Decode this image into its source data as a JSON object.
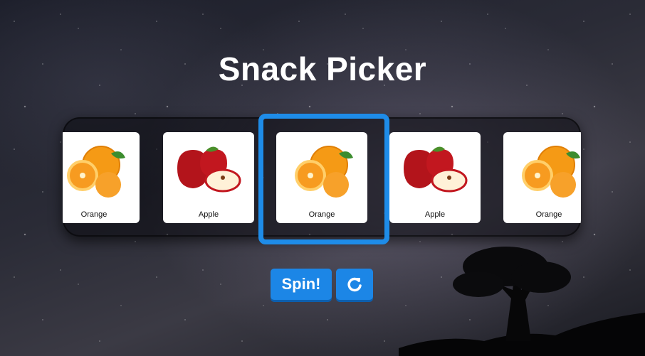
{
  "header": {
    "title": "Snack Picker"
  },
  "reel": {
    "items": [
      {
        "label": "Orange",
        "icon": "orange-icon"
      },
      {
        "label": "Apple",
        "icon": "apple-icon"
      },
      {
        "label": "Orange",
        "icon": "orange-icon"
      },
      {
        "label": "Apple",
        "icon": "apple-icon"
      },
      {
        "label": "Orange",
        "icon": "orange-icon"
      }
    ],
    "selected_index": 2
  },
  "controls": {
    "spin_label": "Spin!",
    "reset_icon": "refresh-icon"
  },
  "colors": {
    "accent": "#1c86e6",
    "selector": "#1e8ce8",
    "title": "#ffffff"
  }
}
